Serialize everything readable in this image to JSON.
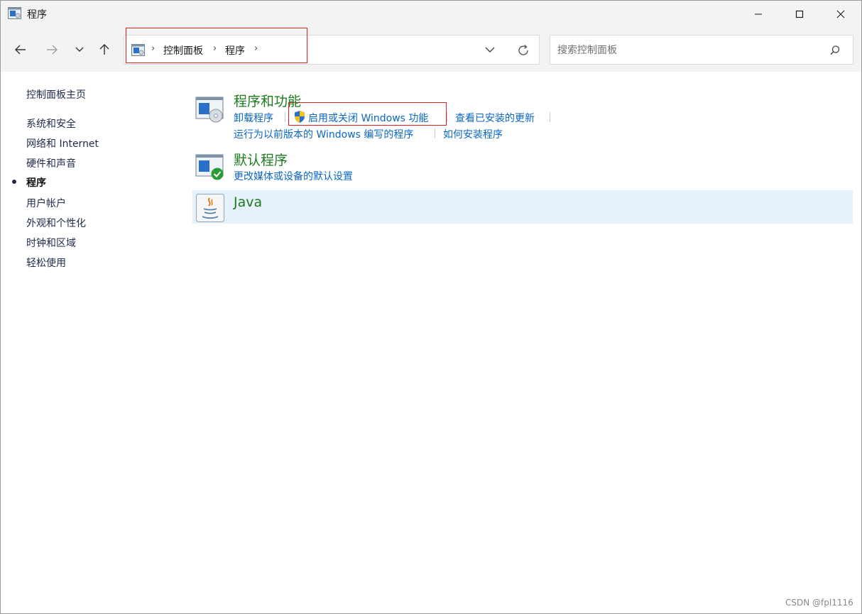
{
  "window": {
    "title": "程序",
    "icon": "control-panel-icon"
  },
  "nav": {
    "back_icon": "arrow-left-icon",
    "forward_icon": "arrow-right-icon",
    "recent_icon": "chevron-down-icon",
    "up_icon": "arrow-up-icon"
  },
  "address": {
    "crumbs": [
      "控制面板",
      "程序"
    ],
    "dropdown_icon": "chevron-down-icon",
    "refresh_icon": "refresh-icon"
  },
  "search": {
    "placeholder": "搜索控制面板",
    "value": "",
    "icon": "search-icon"
  },
  "sidebar": {
    "home": "控制面板主页",
    "items": [
      {
        "label": "系统和安全",
        "active": false
      },
      {
        "label": "网络和 Internet",
        "active": false
      },
      {
        "label": "硬件和声音",
        "active": false
      },
      {
        "label": "程序",
        "active": true
      },
      {
        "label": "用户帐户",
        "active": false
      },
      {
        "label": "外观和个性化",
        "active": false
      },
      {
        "label": "时钟和区域",
        "active": false
      },
      {
        "label": "轻松使用",
        "active": false
      }
    ]
  },
  "categories": {
    "programs_features": {
      "title": "程序和功能",
      "icon": "programs-features-icon",
      "links": [
        "卸载程序",
        "启用或关闭 Windows 功能",
        "查看已安装的更新",
        "运行为以前版本的 Windows 编写的程序",
        "如何安装程序"
      ]
    },
    "default_programs": {
      "title": "默认程序",
      "icon": "default-programs-icon",
      "links": [
        "更改媒体或设备的默认设置"
      ]
    },
    "java": {
      "title": "Java",
      "icon": "java-icon"
    }
  },
  "colors": {
    "category_title": "#1d7a1d",
    "link": "#0a66c2",
    "highlight": "#e02020",
    "selected_row": "#e5f1fb"
  },
  "watermark": "CSDN @fpl1116"
}
